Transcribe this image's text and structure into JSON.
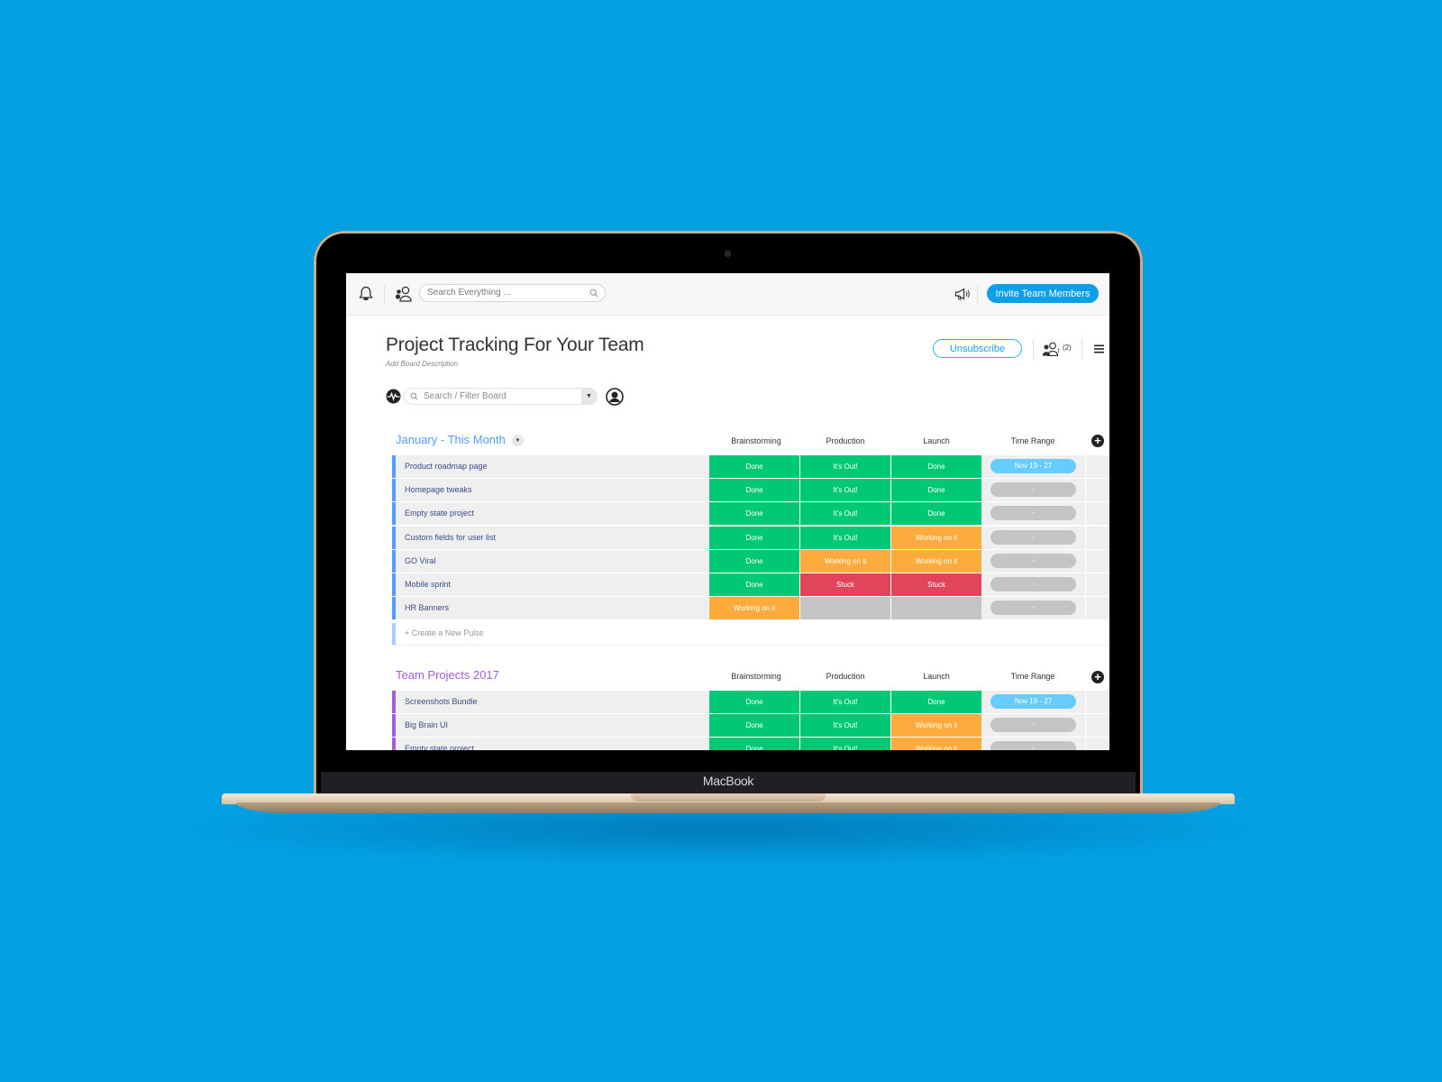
{
  "device": {
    "brand_label": "MacBook"
  },
  "topbar": {
    "search_placeholder": "Search Everything ...",
    "invite_label": "Invite Team Members"
  },
  "board": {
    "title": "Project Tracking For Your Team",
    "description_placeholder": "Add Board Description",
    "unsubscribe_label": "Unsubscribe",
    "members_count": "(2)",
    "filter_placeholder": "Search / Filter Board"
  },
  "colors": {
    "done": "#00c875",
    "working": "#fdab3d",
    "stuck": "#e2445c",
    "empty": "#c4c4c4",
    "timerange_active": "#66ccff",
    "timerange_empty": "#c4c4c4",
    "group1": "#579bfc",
    "group2": "#a25ddc"
  },
  "columns": [
    "Brainstorming",
    "Production",
    "Launch",
    "Time Range"
  ],
  "groups": [
    {
      "title": "January - This Month",
      "new_pulse_placeholder": "+ Create a New Pulse",
      "rows": [
        {
          "name": "Product roadmap page",
          "brainstorming": "Done",
          "production": "It's Out!",
          "launch": "Done",
          "time_range": "Nov 19 - 27"
        },
        {
          "name": "Homepage tweaks",
          "brainstorming": "Done",
          "production": "It's Out!",
          "launch": "Done",
          "time_range": "-"
        },
        {
          "name": "Empty state project",
          "brainstorming": "Done",
          "production": "It's Out!",
          "launch": "Done",
          "time_range": "-"
        },
        {
          "name": "Custom fields for user list",
          "brainstorming": "Done",
          "production": "It's Out!",
          "launch": "Working on it",
          "time_range": "-"
        },
        {
          "name": "GO Viral",
          "brainstorming": "Done",
          "production": "Working on it",
          "launch": "Working on it",
          "time_range": "-"
        },
        {
          "name": "Mobile sprint",
          "brainstorming": "Done",
          "production": "Stuck",
          "launch": "Stuck",
          "time_range": "-"
        },
        {
          "name": "HR Banners",
          "brainstorming": "Working on it",
          "production": "",
          "launch": "",
          "time_range": "-"
        }
      ]
    },
    {
      "title": "Team Projects 2017",
      "rows": [
        {
          "name": "Screenshots Bundle",
          "brainstorming": "Done",
          "production": "It's Out!",
          "launch": "Done",
          "time_range": "Nov 19 - 27"
        },
        {
          "name": "Big Brain UI",
          "brainstorming": "Done",
          "production": "It's Out!",
          "launch": "Working on it",
          "time_range": "-"
        },
        {
          "name": "Empty state project",
          "brainstorming": "Done",
          "production": "It's Out!",
          "launch": "Working on it",
          "time_range": "-"
        }
      ]
    }
  ]
}
